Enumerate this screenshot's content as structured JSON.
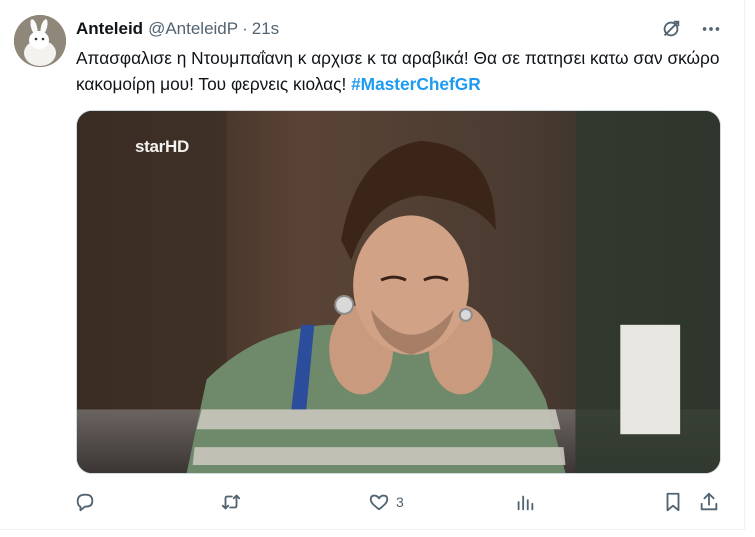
{
  "tweet": {
    "display_name": "Anteleid",
    "handle": "@AnteleidP",
    "separator": "·",
    "time": "21s",
    "text_before": "Απασφαλισε η Ντουμπαΐανη κ αρχισε κ τα αραβικά! Θα σε πατησει κατω σαν σκώρο κακομοίρη μου! Του φερνεις κιολας! ",
    "hashtag": "#MasterChefGR",
    "watermark": "starHD"
  },
  "icons": {
    "grok": "grok-icon",
    "more": "more-icon",
    "reply": "reply-icon",
    "retweet": "retweet-icon",
    "like": "like-icon",
    "views": "views-icon",
    "bookmark": "bookmark-icon",
    "share": "share-icon"
  },
  "actions": {
    "reply_count": "",
    "retweet_count": "",
    "like_count": "3",
    "views_count": ""
  },
  "colors": {
    "text": "#0f1419",
    "secondary": "#536471",
    "accent": "#1d9bf0",
    "border": "#cfd9de"
  }
}
